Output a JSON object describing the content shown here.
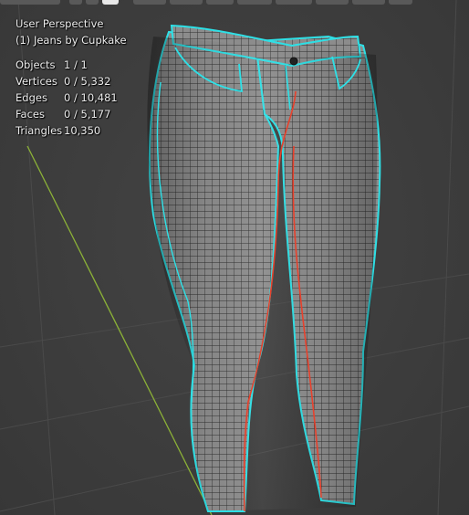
{
  "viewport": {
    "view_name": "User Perspective",
    "object_name": "(1) Jeans by Cupkake"
  },
  "stats": [
    {
      "label": "Objects",
      "value": "1 / 1"
    },
    {
      "label": "Vertices",
      "value": "0 / 5,332"
    },
    {
      "label": "Edges",
      "value": "0 / 10,481"
    },
    {
      "label": "Faces",
      "value": "0 / 5,177"
    },
    {
      "label": "Triangles",
      "value": "10,350"
    }
  ],
  "colors": {
    "background": "#3c3c3c",
    "grid_line": "#4a4a4a",
    "y_axis": "#8bb137",
    "mesh_fill": "#8a8a8a",
    "mesh_wire": "#2c2c2c",
    "seam": "#e8412c",
    "boundary": "#2ee0e6"
  }
}
